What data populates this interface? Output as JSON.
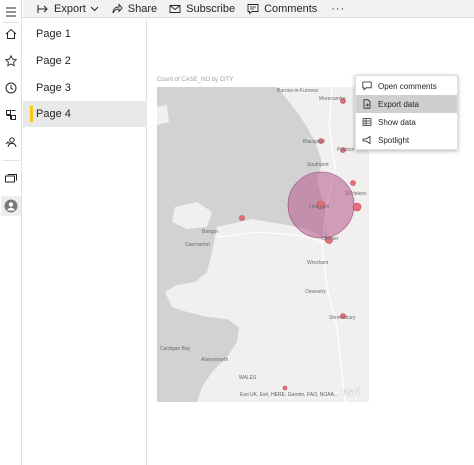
{
  "toolbar": {
    "export_label": "Export",
    "share_label": "Share",
    "subscribe_label": "Subscribe",
    "comments_label": "Comments",
    "more_label": "···"
  },
  "pages": [
    {
      "label": "Page 1",
      "active": false
    },
    {
      "label": "Page 2",
      "active": false
    },
    {
      "label": "Page 3",
      "active": false
    },
    {
      "label": "Page 4",
      "active": true
    }
  ],
  "visual": {
    "title": "Count of CASE_NO by CITY",
    "attribution": "Esri UK, Esri, HERE, Garmin, FAO, NOAA...",
    "logo": "esri",
    "bubble_color": "#b45a8c"
  },
  "context_menu": {
    "items": [
      {
        "label": "Open comments",
        "icon": "comment-icon",
        "hover": false
      },
      {
        "label": "Export data",
        "icon": "export-data-icon",
        "hover": true
      },
      {
        "label": "Show data",
        "icon": "table-icon",
        "hover": false
      },
      {
        "label": "Spotlight",
        "icon": "spotlight-icon",
        "hover": false
      }
    ]
  },
  "map_labels": {
    "barrow": "Barrow-in-Furness",
    "morecambe": "Morecambe",
    "blackpool": "Blackpool",
    "preston": "Preston",
    "southport": "Southport",
    "sthelens": "St Helens",
    "liverpool": "Liverpool",
    "bangor": "Bangor",
    "caernarfon": "Caernarfon",
    "chester": "Chester",
    "wrexham": "Wrexham",
    "oswestry": "Oswestry",
    "shrewsbury": "Shrewsbury",
    "cardigan": "Cardigan Bay",
    "aberystwyth": "Aberystwyth",
    "wales": "WALES"
  }
}
